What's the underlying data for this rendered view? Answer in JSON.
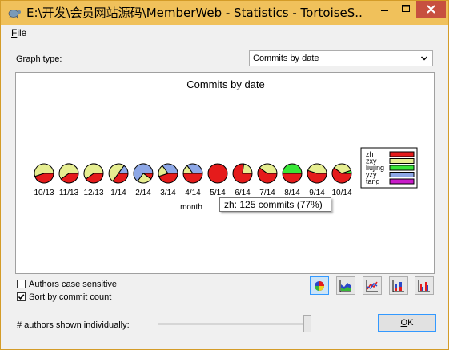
{
  "window": {
    "title": "E:\\开发\\会员网站源码\\MemberWeb - Statistics - TortoiseS...",
    "colors": {
      "frame": "#f0c15b",
      "close": "#c7503f"
    }
  },
  "menu": {
    "file_prefix": "F",
    "file_rest": "ile"
  },
  "graph_type": {
    "label": "Graph type:",
    "selected": "Commits by date"
  },
  "chart_data": {
    "type": "pie",
    "title": "Commits by date",
    "xlabel": "month",
    "categories": [
      "10/13",
      "11/13",
      "12/13",
      "1/14",
      "2/14",
      "3/14",
      "4/14",
      "5/14",
      "6/14",
      "7/14",
      "8/14",
      "9/14",
      "10/14"
    ],
    "series": [
      {
        "name": "zh",
        "color": "#e51b1b",
        "values": [
          45,
          40,
          40,
          35,
          10,
          45,
          50,
          100,
          77,
          60,
          50,
          55,
          60
        ]
      },
      {
        "name": "zxy",
        "color": "#e6ee91",
        "values": [
          55,
          60,
          60,
          50,
          25,
          20,
          15,
          0,
          23,
          40,
          0,
          45,
          35
        ]
      },
      {
        "name": "liujing",
        "color": "#38e638",
        "values": [
          0,
          0,
          0,
          0,
          0,
          0,
          0,
          0,
          0,
          0,
          50,
          0,
          5
        ]
      },
      {
        "name": "yzy",
        "color": "#8da7e6",
        "values": [
          0,
          0,
          0,
          15,
          65,
          35,
          35,
          0,
          0,
          0,
          0,
          0,
          0
        ]
      },
      {
        "name": "tang",
        "color": "#c81cc8",
        "values": [
          0,
          0,
          0,
          0,
          0,
          0,
          0,
          0,
          0,
          0,
          0,
          0,
          0
        ]
      }
    ],
    "legend_position": "right"
  },
  "tooltip": {
    "text": "zh: 125 commits (77%)"
  },
  "options": {
    "case_sensitive": {
      "label": "Authors case sensitive",
      "checked": false
    },
    "sort_by_count": {
      "label": "Sort by commit count",
      "checked": true
    }
  },
  "toolbar": {
    "buttons": [
      {
        "name": "pie-chart-icon",
        "active": true
      },
      {
        "name": "area-chart-icon",
        "active": false
      },
      {
        "name": "line-chart-icon",
        "active": false
      },
      {
        "name": "stacked-bar-chart-icon",
        "active": false
      },
      {
        "name": "bar-chart-icon",
        "active": false
      }
    ]
  },
  "authors_slider": {
    "label": "# authors shown individually:",
    "value_fraction": 1.0
  },
  "ok_button": {
    "prefix": "O",
    "rest": "K"
  }
}
